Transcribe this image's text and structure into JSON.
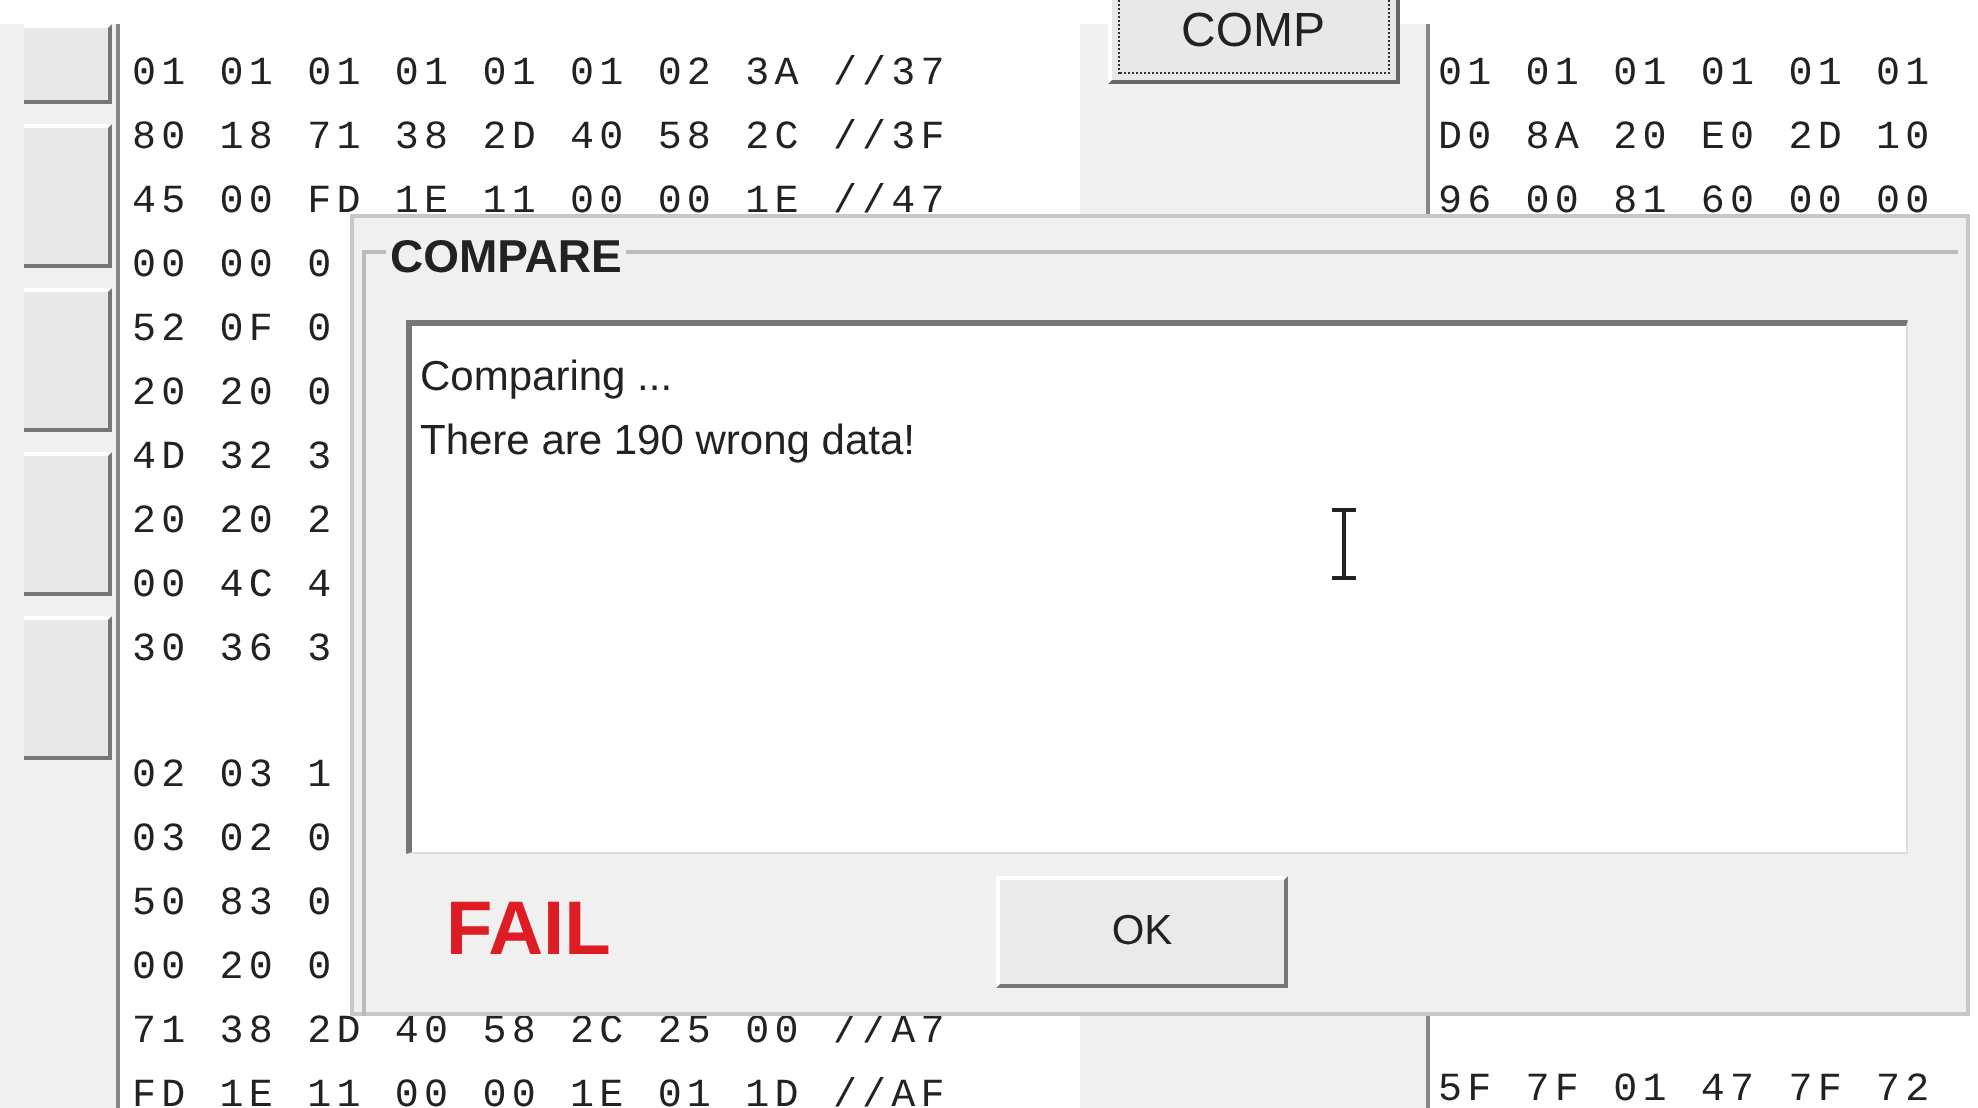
{
  "left_hex_blocks": [
    [
      "01 01 01 01 01 01 02 3A //37",
      "80 18 71 38 2D 40 58 2C //3F",
      "45 00 FD 1E 11 00 00 1E //47",
      "00 00 0",
      "52 0F 0",
      "20 20 0",
      "4D 32 3",
      "20 20 2",
      "00 4C 4",
      "30 36 3"
    ],
    [
      "02 03 1",
      "03 02 0",
      "50 83 0",
      "00 20 0",
      "71 38 2D 40 58 2C 25 00 //A7",
      "FD 1E 11 00 00 1E 01 1D //AF"
    ]
  ],
  "compare_button": "COMP",
  "right_hex_top": [
    "01 01 01 01 01 01",
    "D0 8A 20 E0 2D 10",
    "96 00 81 60 00 00"
  ],
  "right_hex_bottom": [
    "5F 7F 01 47 7F 72"
  ],
  "dialog": {
    "title": "COMPARE",
    "messages": [
      "Comparing ...",
      "There are 190 wrong data!"
    ],
    "result": "FAIL",
    "ok_button": "OK"
  }
}
